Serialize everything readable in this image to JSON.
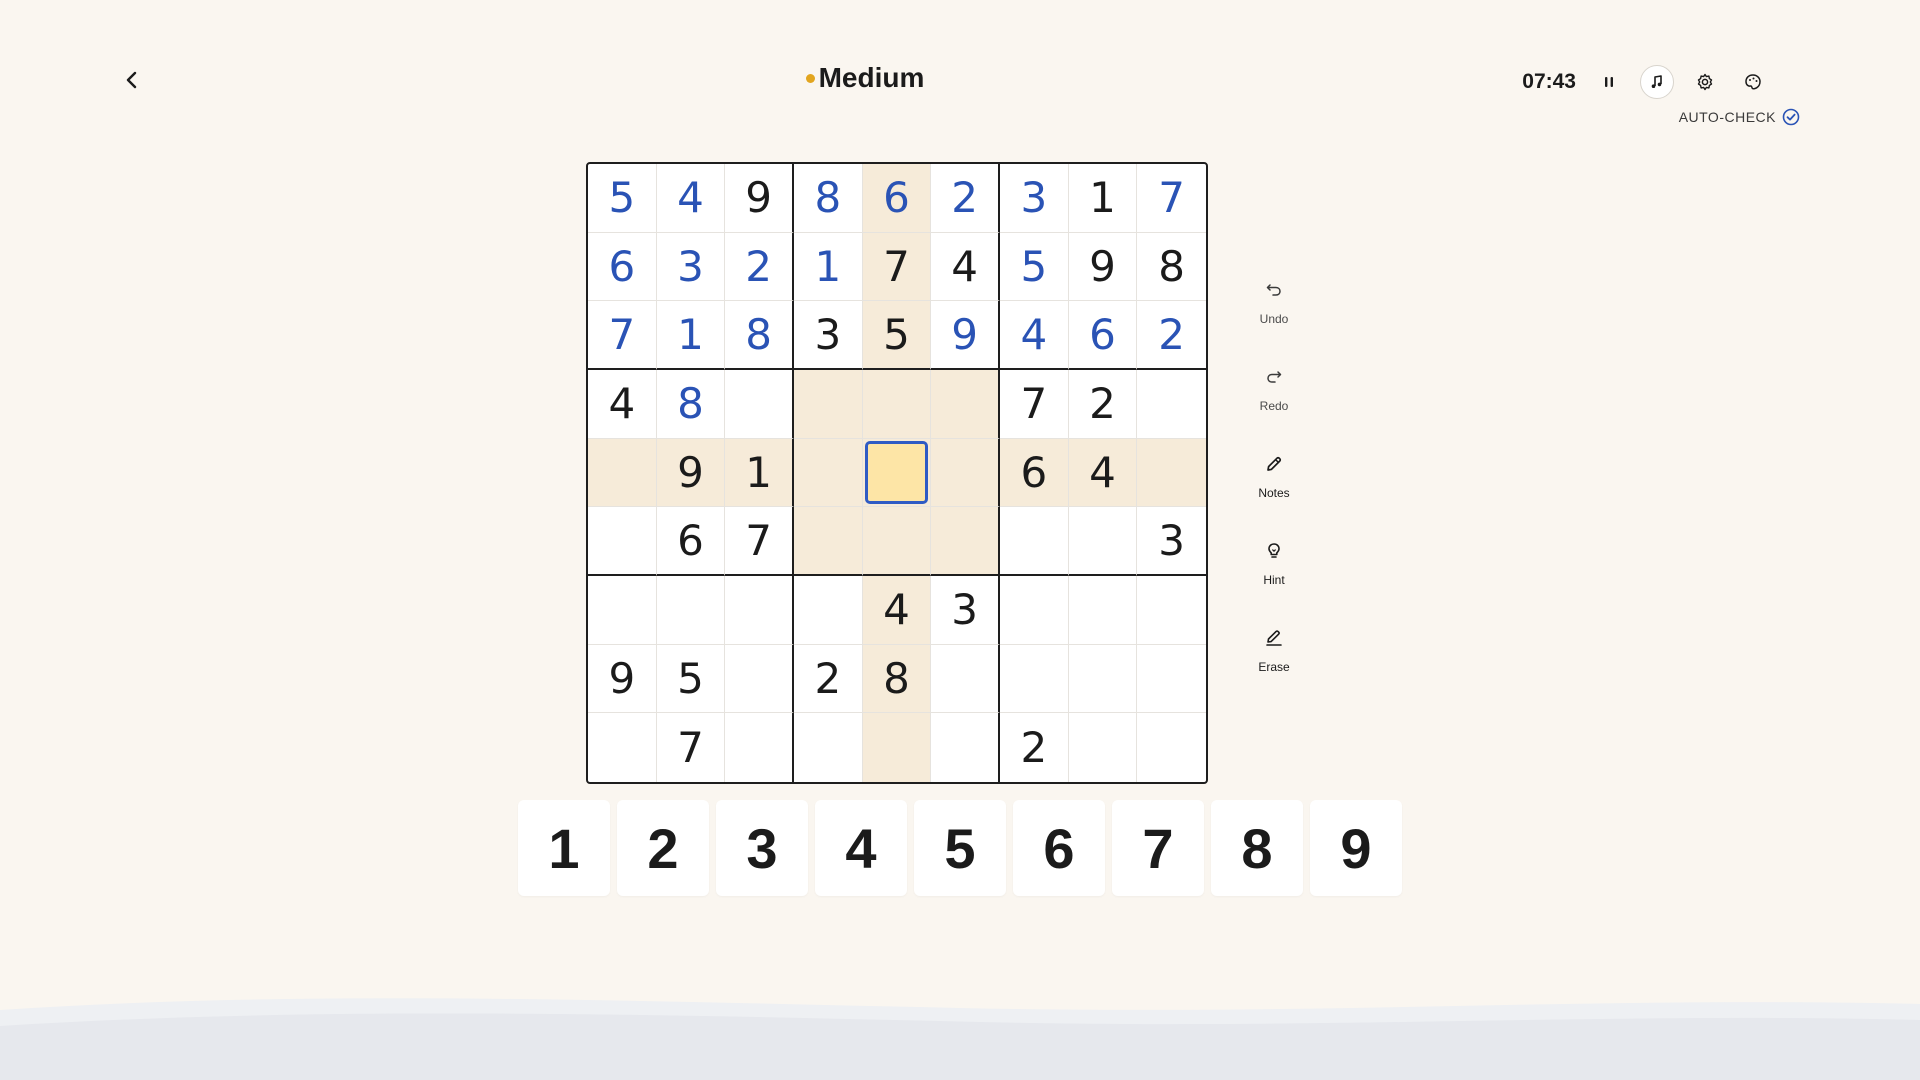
{
  "header": {
    "difficulty": "Medium",
    "difficulty_color": "#e2a51f",
    "timer": "07:43",
    "auto_check_label": "AUTO-CHECK",
    "icons": [
      "chevron-left-icon",
      "pause-icon",
      "music-note-icon",
      "gear-icon",
      "palette-icon",
      "check-circle-icon"
    ]
  },
  "colors": {
    "background": "#faf6f0",
    "user_digit": "#2a53b5",
    "given_digit": "#1b1b1b",
    "highlight": "#f6ebd9",
    "selected_fill": "#fde5a6",
    "selected_border": "#2f5bc4"
  },
  "board": {
    "selected": [
      4,
      4
    ],
    "cells": [
      [
        {
          "v": "5",
          "t": "user"
        },
        {
          "v": "4",
          "t": "user"
        },
        {
          "v": "9",
          "t": "given"
        },
        {
          "v": "8",
          "t": "user"
        },
        {
          "v": "6",
          "t": "user"
        },
        {
          "v": "2",
          "t": "user"
        },
        {
          "v": "3",
          "t": "user"
        },
        {
          "v": "1",
          "t": "given"
        },
        {
          "v": "7",
          "t": "user"
        }
      ],
      [
        {
          "v": "6",
          "t": "user"
        },
        {
          "v": "3",
          "t": "user"
        },
        {
          "v": "2",
          "t": "user"
        },
        {
          "v": "1",
          "t": "user"
        },
        {
          "v": "7",
          "t": "given"
        },
        {
          "v": "4",
          "t": "given"
        },
        {
          "v": "5",
          "t": "user"
        },
        {
          "v": "9",
          "t": "given"
        },
        {
          "v": "8",
          "t": "given"
        }
      ],
      [
        {
          "v": "7",
          "t": "user"
        },
        {
          "v": "1",
          "t": "user"
        },
        {
          "v": "8",
          "t": "user"
        },
        {
          "v": "3",
          "t": "given"
        },
        {
          "v": "5",
          "t": "given"
        },
        {
          "v": "9",
          "t": "user"
        },
        {
          "v": "4",
          "t": "user"
        },
        {
          "v": "6",
          "t": "user"
        },
        {
          "v": "2",
          "t": "user"
        }
      ],
      [
        {
          "v": "4",
          "t": "given"
        },
        {
          "v": "8",
          "t": "user"
        },
        {
          "v": "",
          "t": "empty"
        },
        {
          "v": "",
          "t": "empty"
        },
        {
          "v": "",
          "t": "empty"
        },
        {
          "v": "",
          "t": "empty"
        },
        {
          "v": "7",
          "t": "given"
        },
        {
          "v": "2",
          "t": "given"
        },
        {
          "v": "",
          "t": "empty"
        }
      ],
      [
        {
          "v": "",
          "t": "empty"
        },
        {
          "v": "9",
          "t": "given"
        },
        {
          "v": "1",
          "t": "given"
        },
        {
          "v": "",
          "t": "empty"
        },
        {
          "v": "",
          "t": "empty"
        },
        {
          "v": "",
          "t": "empty"
        },
        {
          "v": "6",
          "t": "given"
        },
        {
          "v": "4",
          "t": "given"
        },
        {
          "v": "",
          "t": "empty"
        }
      ],
      [
        {
          "v": "",
          "t": "empty"
        },
        {
          "v": "6",
          "t": "given"
        },
        {
          "v": "7",
          "t": "given"
        },
        {
          "v": "",
          "t": "empty"
        },
        {
          "v": "",
          "t": "empty"
        },
        {
          "v": "",
          "t": "empty"
        },
        {
          "v": "",
          "t": "empty"
        },
        {
          "v": "",
          "t": "empty"
        },
        {
          "v": "3",
          "t": "given"
        }
      ],
      [
        {
          "v": "",
          "t": "empty"
        },
        {
          "v": "",
          "t": "empty"
        },
        {
          "v": "",
          "t": "empty"
        },
        {
          "v": "",
          "t": "empty"
        },
        {
          "v": "4",
          "t": "given"
        },
        {
          "v": "3",
          "t": "given"
        },
        {
          "v": "",
          "t": "empty"
        },
        {
          "v": "",
          "t": "empty"
        },
        {
          "v": "",
          "t": "empty"
        }
      ],
      [
        {
          "v": "9",
          "t": "given"
        },
        {
          "v": "5",
          "t": "given"
        },
        {
          "v": "",
          "t": "empty"
        },
        {
          "v": "2",
          "t": "given"
        },
        {
          "v": "8",
          "t": "given"
        },
        {
          "v": "",
          "t": "empty"
        },
        {
          "v": "",
          "t": "empty"
        },
        {
          "v": "",
          "t": "empty"
        },
        {
          "v": "",
          "t": "empty"
        }
      ],
      [
        {
          "v": "",
          "t": "empty"
        },
        {
          "v": "7",
          "t": "given"
        },
        {
          "v": "",
          "t": "empty"
        },
        {
          "v": "",
          "t": "empty"
        },
        {
          "v": "",
          "t": "empty"
        },
        {
          "v": "",
          "t": "empty"
        },
        {
          "v": "2",
          "t": "given"
        },
        {
          "v": "",
          "t": "empty"
        },
        {
          "v": "",
          "t": "empty"
        }
      ]
    ]
  },
  "tools": {
    "undo": {
      "label": "Undo",
      "icon": "undo-icon"
    },
    "redo": {
      "label": "Redo",
      "icon": "redo-icon"
    },
    "notes": {
      "label": "Notes",
      "icon": "pencil-icon"
    },
    "hint": {
      "label": "Hint",
      "icon": "lightbulb-icon"
    },
    "erase": {
      "label": "Erase",
      "icon": "eraser-icon"
    }
  },
  "numpad": [
    "1",
    "2",
    "3",
    "4",
    "5",
    "6",
    "7",
    "8",
    "9"
  ]
}
